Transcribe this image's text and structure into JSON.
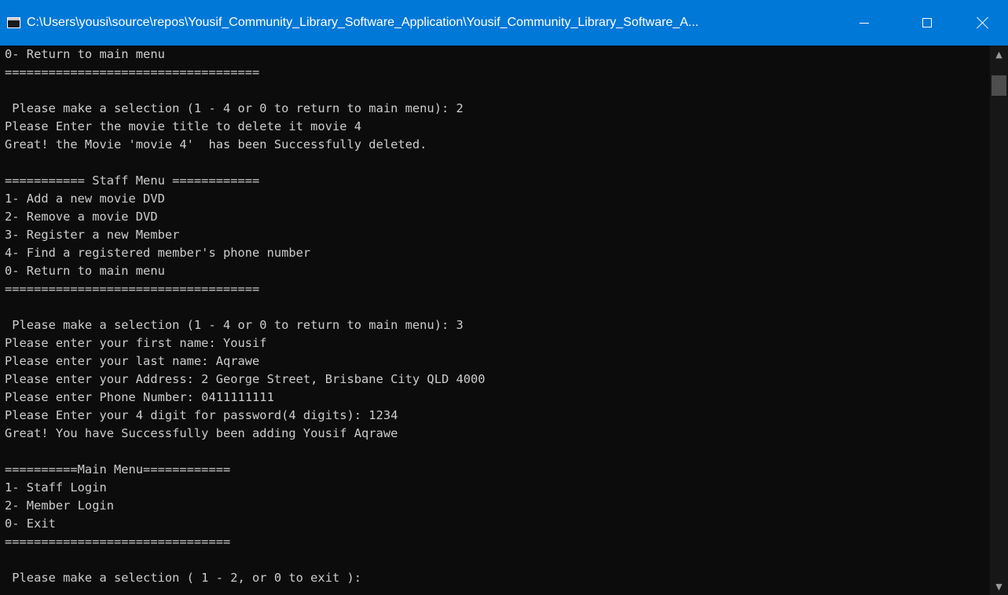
{
  "window": {
    "title": "C:\\Users\\yousi\\source\\repos\\Yousif_Community_Library_Software_Application\\Yousif_Community_Library_Software_A...",
    "icons": {
      "app": "console-app-icon",
      "minimize": "minimize-icon",
      "maximize": "maximize-icon",
      "close": "close-icon"
    },
    "colors": {
      "titlebar": "#0078d7",
      "console_bg": "#0c0c0c",
      "console_text": "#cccccc"
    }
  },
  "console": {
    "lines": [
      "0- Return to main menu",
      "===================================",
      "",
      " Please make a selection (1 - 4 or 0 to return to main menu): 2",
      "Please Enter the movie title to delete it movie 4",
      "Great! the Movie 'movie 4'  has been Successfully deleted.",
      "",
      "=========== Staff Menu ============",
      "1- Add a new movie DVD",
      "2- Remove a movie DVD",
      "3- Register a new Member",
      "4- Find a registered member's phone number",
      "0- Return to main menu",
      "===================================",
      "",
      " Please make a selection (1 - 4 or 0 to return to main menu): 3",
      "Please enter your first name: Yousif",
      "Please enter your last name: Aqrawe",
      "Please enter your Address: 2 George Street, Brisbane City QLD 4000",
      "Please enter Phone Number: 0411111111",
      "Please Enter your 4 digit for password(4 digits): 1234",
      "Great! You have Successfully been adding Yousif Aqrawe",
      "",
      "==========Main Menu============",
      "1- Staff Login",
      "2- Member Login",
      "0- Exit",
      "===============================",
      "",
      " Please make a selection ( 1 - 2, or 0 to exit ):"
    ]
  },
  "scrollbar": {
    "up_icon": "scroll-up-arrow-icon",
    "down_icon": "scroll-down-arrow-icon"
  }
}
